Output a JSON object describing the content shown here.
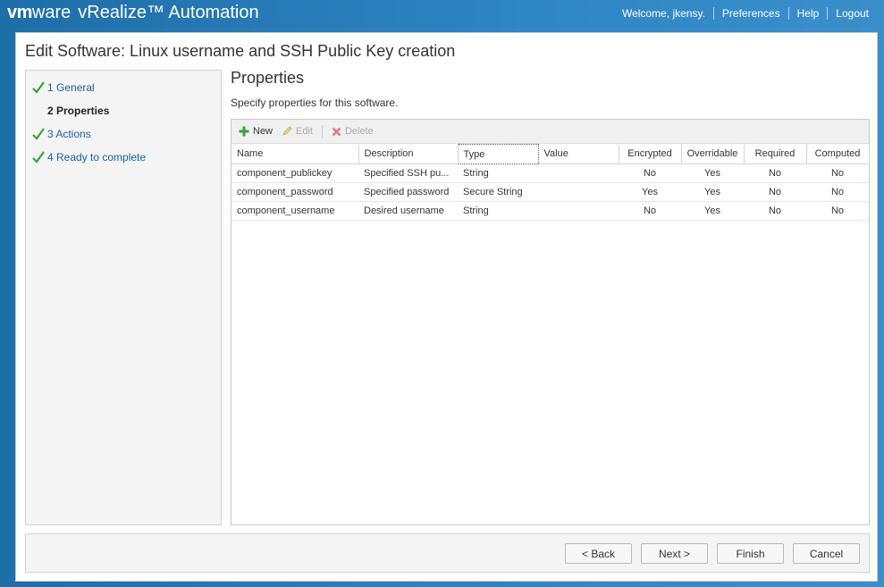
{
  "header": {
    "brand_vm": "vm",
    "brand_ware": "ware",
    "product": "vRealize™ Automation",
    "welcome": "Welcome, jkensy.",
    "preferences": "Preferences",
    "help": "Help",
    "logout": "Logout"
  },
  "dialog": {
    "title": "Edit Software: Linux username and SSH Public Key creation"
  },
  "steps": [
    {
      "label": "1 General",
      "done": true
    },
    {
      "label": "2 Properties",
      "done": false
    },
    {
      "label": "3 Actions",
      "done": true
    },
    {
      "label": "4 Ready to complete",
      "done": true
    }
  ],
  "content": {
    "title": "Properties",
    "subtitle": "Specify properties for this software."
  },
  "toolbar": {
    "new": "New",
    "edit": "Edit",
    "delete": "Delete"
  },
  "table": {
    "columns": [
      "Name",
      "Description",
      "Type",
      "Value",
      "Encrypted",
      "Overridable",
      "Required",
      "Computed"
    ],
    "rows": [
      [
        "component_publickey",
        "Specified SSH pu...",
        "String",
        "",
        "No",
        "Yes",
        "No",
        "No"
      ],
      [
        "component_password",
        "Specified password",
        "Secure String",
        "",
        "Yes",
        "Yes",
        "No",
        "No"
      ],
      [
        "component_username",
        "Desired username",
        "String",
        "",
        "No",
        "Yes",
        "No",
        "No"
      ]
    ]
  },
  "footer": {
    "back": "< Back",
    "next": "Next >",
    "finish": "Finish",
    "cancel": "Cancel"
  },
  "colors": {
    "header_bg": "#2f86c4",
    "link": "#1a5f9c",
    "check": "#3aa33a"
  }
}
